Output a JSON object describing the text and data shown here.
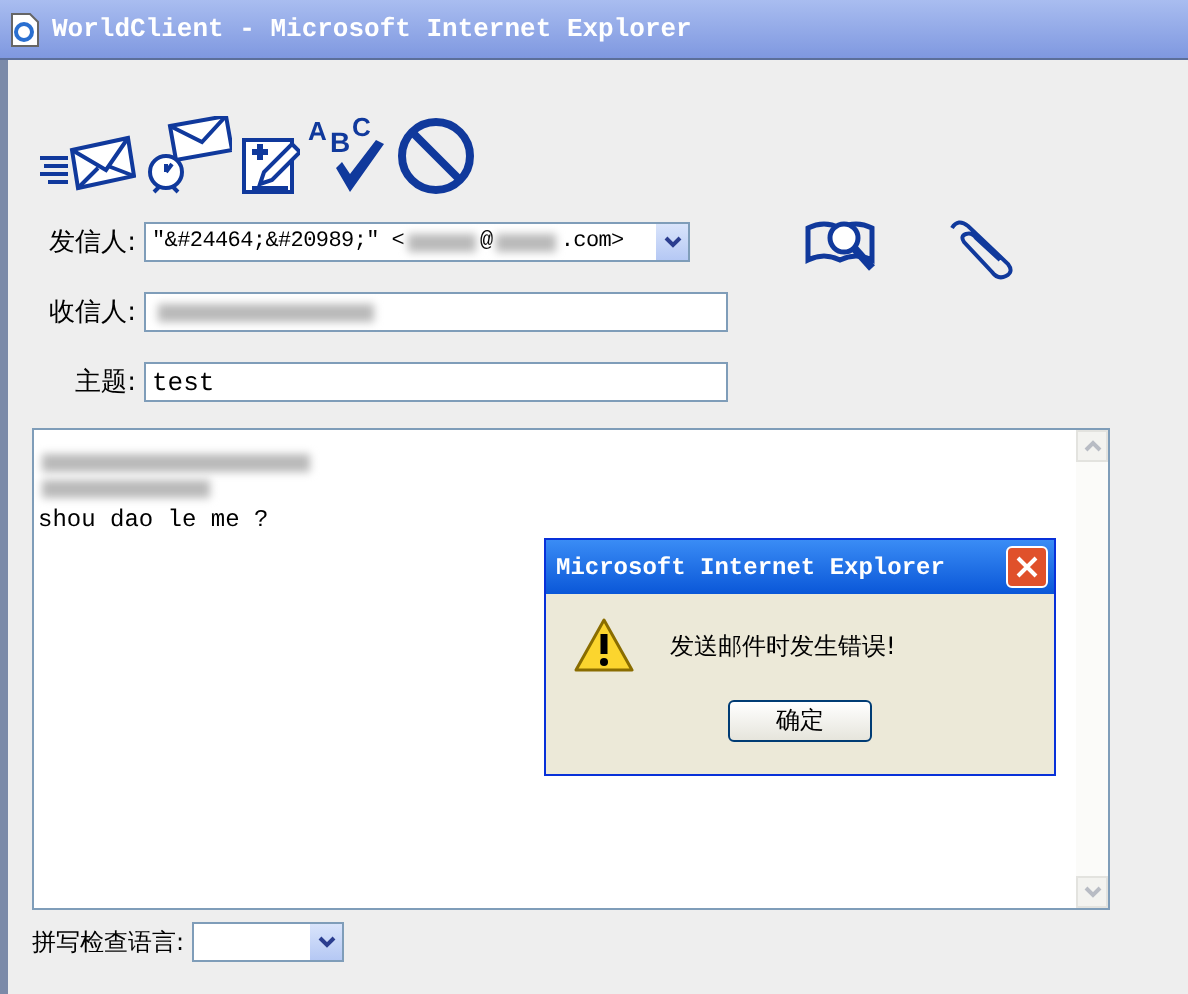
{
  "window": {
    "title": "WorldClient - Microsoft Internet Explorer"
  },
  "toolbar": {
    "spell_letters": "ABC"
  },
  "form": {
    "sender": {
      "label": "发信人:",
      "value_parts": [
        "\"&#24464;&#20989;\" <",
        "@",
        ".com>"
      ]
    },
    "recipient": {
      "label": "收信人:"
    },
    "subject": {
      "label": "主题:",
      "value": "test"
    }
  },
  "body": {
    "text": "shou dao le me ?"
  },
  "spellcheck": {
    "label": "拼写检查语言:"
  },
  "dialog": {
    "title": "Microsoft Internet Explorer",
    "message": "发送邮件时发生错误!",
    "button": "确定"
  }
}
